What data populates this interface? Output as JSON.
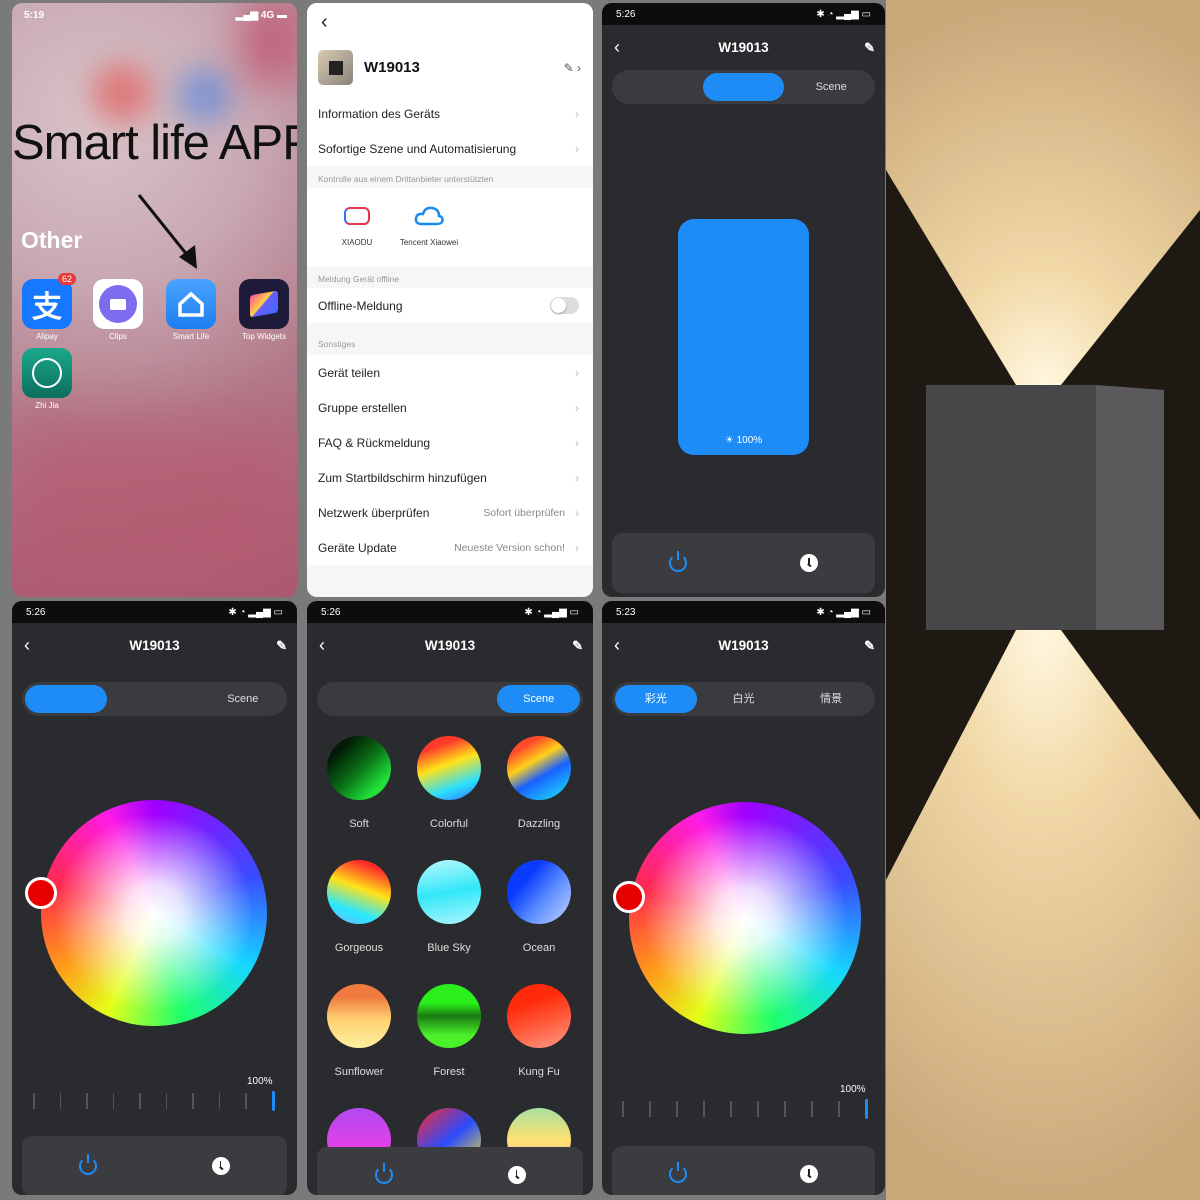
{
  "home": {
    "status_time": "5:19",
    "status_network": "4G",
    "headline": "Smart life APP",
    "folder_title": "Other",
    "apps": [
      {
        "label": "Alipay",
        "badge": "62",
        "icon": "alipay-icon"
      },
      {
        "label": "Clips",
        "icon": "clips-icon"
      },
      {
        "label": "Smart Life",
        "icon": "smart-life-icon"
      },
      {
        "label": "Top Widgets",
        "icon": "top-widgets-icon"
      },
      {
        "label": "Zhi Jia",
        "icon": "zhi-jia-icon"
      }
    ]
  },
  "settings": {
    "device_name": "W19013",
    "rows_top": [
      {
        "label": "Information des Geräts"
      },
      {
        "label": "Sofortige Szene und Automatisierung"
      }
    ],
    "third_party_header": "Kontrolle aus einem Drittanbieter unterstützten",
    "third_party": [
      {
        "label": "XIAODU",
        "icon": "xiaodu-icon"
      },
      {
        "label": "Tencent Xiaowei",
        "icon": "tencent-cloud-icon"
      }
    ],
    "offline_header": "Meldung Gerät offline",
    "offline_label": "Offline-Meldung",
    "offline_enabled": false,
    "misc_header": "Sonstiges",
    "rows_misc": [
      {
        "label": "Gerät teilen",
        "value": ""
      },
      {
        "label": "Gruppe erstellen",
        "value": ""
      },
      {
        "label": "FAQ & Rückmeldung",
        "value": ""
      },
      {
        "label": "Zum Startbildschirm hinzufügen",
        "value": ""
      },
      {
        "label": "Netzwerk überprüfen",
        "value": "Sofort überprüfen"
      },
      {
        "label": "Geräte Update",
        "value": "Neueste Version schon!"
      }
    ]
  },
  "white_screen": {
    "time": "5:26",
    "title": "W19013",
    "tabs": [
      "",
      "",
      "Scene"
    ],
    "active_tab": 1,
    "brightness_label": "100%"
  },
  "color_screen": {
    "time": "5:26",
    "title": "W19013",
    "tabs": [
      "",
      "",
      "Scene"
    ],
    "active_tab": 0,
    "brightness_label": "100%",
    "brightness_value": 100
  },
  "scene_screen": {
    "time": "5:26",
    "title": "W19013",
    "tabs": [
      "",
      "",
      "Scene"
    ],
    "active_tab": 2,
    "scenes": [
      {
        "name": "Soft"
      },
      {
        "name": "Colorful"
      },
      {
        "name": "Dazzling"
      },
      {
        "name": "Gorgeous"
      },
      {
        "name": "Blue Sky"
      },
      {
        "name": "Ocean"
      },
      {
        "name": "Sunflower"
      },
      {
        "name": "Forest"
      },
      {
        "name": "Kung Fu"
      },
      {
        "name": ""
      },
      {
        "name": ""
      },
      {
        "name": ""
      }
    ]
  },
  "cn_screen": {
    "time": "5:23",
    "title": "W19013",
    "tabs": [
      "彩光",
      "白光",
      "情景"
    ],
    "active_tab": 0,
    "brightness_label": "100%",
    "brightness_value": 100
  },
  "colors": {
    "accent": "#1e8cf7",
    "dark_bg": "#2a2b2e",
    "knob": "#e80000"
  }
}
